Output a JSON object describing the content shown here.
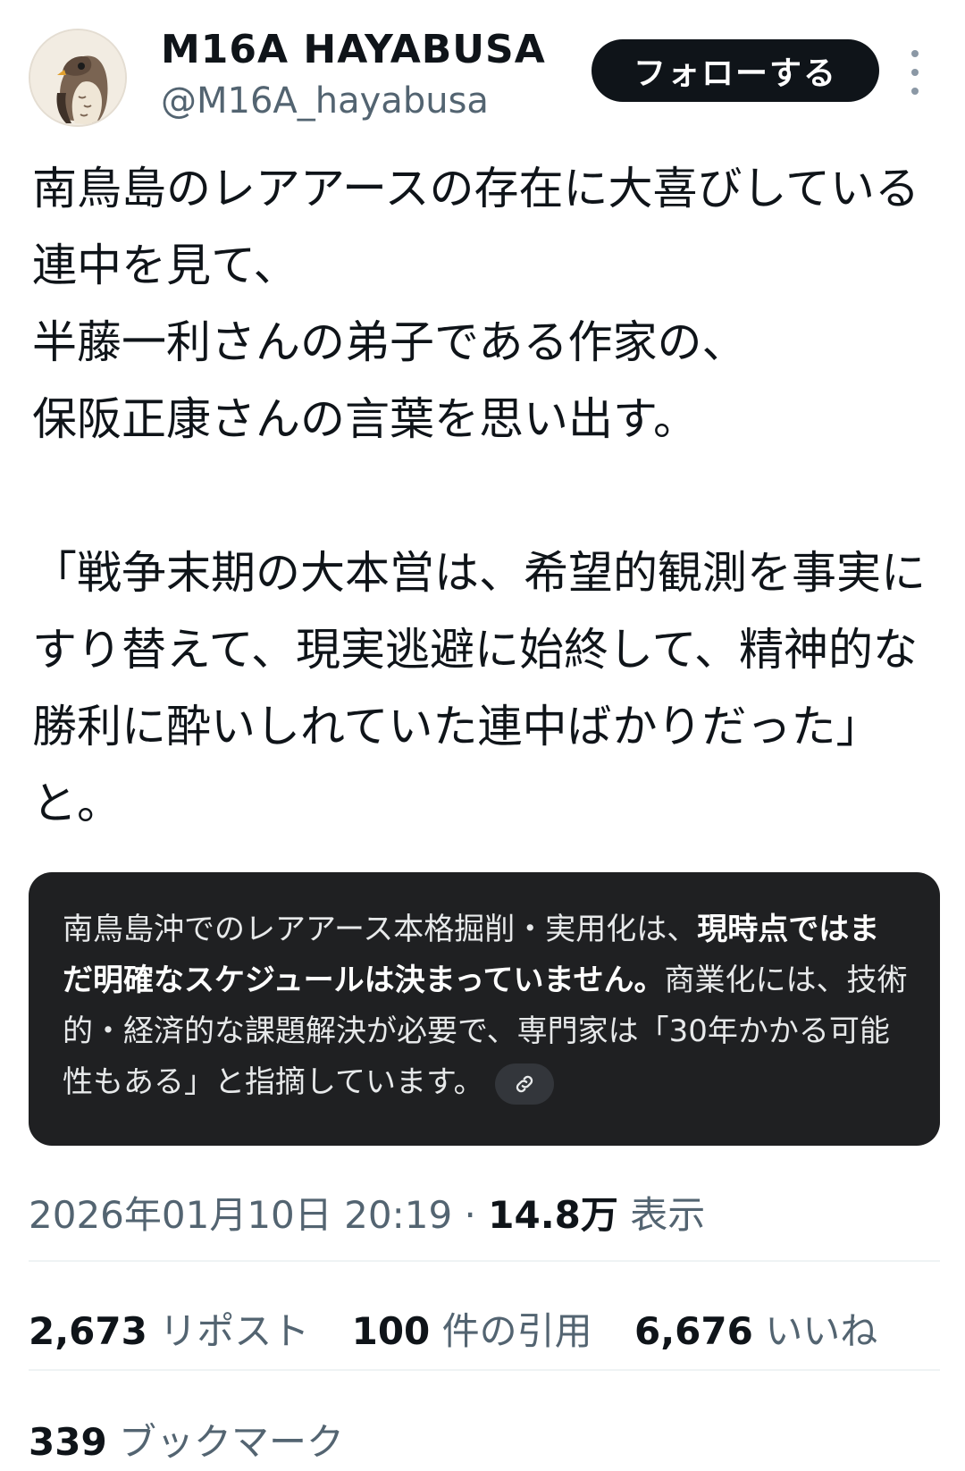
{
  "author": {
    "display_name": "M16A HAYABUSA",
    "handle": "@M16A_hayabusa",
    "avatar_icon": "falcon-avatar-icon"
  },
  "follow_label": "フォローする",
  "more_icon": "vertical-ellipsis-icon",
  "tweet_text": "南鳥島のレアアースの存在に大喜びしている連中を見て、\n半藤一利さんの弟子である作家の、\n保阪正康さんの言葉を思い出す。\n\n「戦争末期の大本営は、希望的観測を事実にすり替えて、現実逃避に始終して、精神的な勝利に酔いしれていた連中ばかりだった」と。",
  "context_note": {
    "text_1": "南鳥島沖でのレアアース本格掘削・実用化は、",
    "text_bold": "現時点ではまだ明確なスケジュールは決まっていません。",
    "text_2": "商業化には、技術的・経済的な課題解決が必要で、専門家は「30年かかる可能性もある」と指摘しています。",
    "link_icon": "link-icon"
  },
  "meta": {
    "timestamp": "2026年01月10日 20:19",
    "separator": "·",
    "views_count": "14.8万",
    "views_label": "表示"
  },
  "stats": {
    "reposts_count": "2,673",
    "reposts_label": "リポスト",
    "quotes_count": "100",
    "quotes_label": "件の引用",
    "likes_count": "6,676",
    "likes_label": "いいね",
    "bookmarks_count": "339",
    "bookmarks_label": "ブックマーク"
  }
}
